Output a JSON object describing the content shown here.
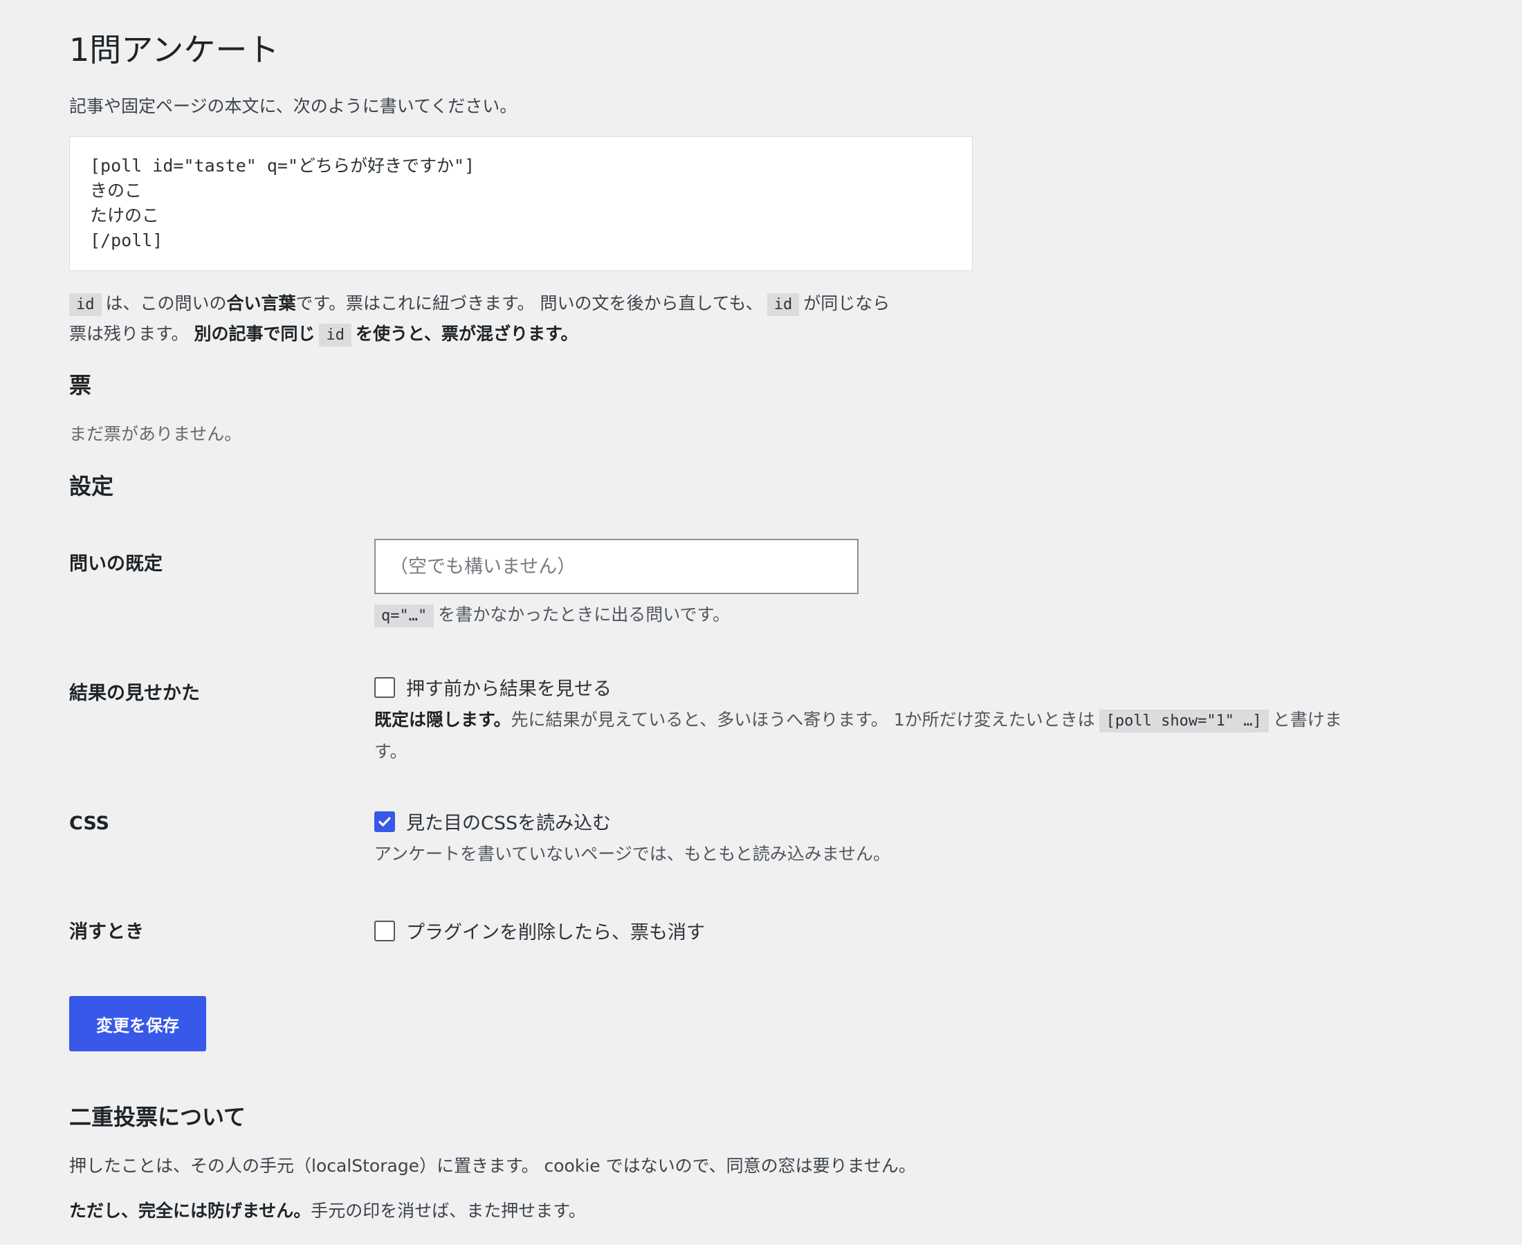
{
  "page": {
    "title": "1問アンケート",
    "intro": "記事や固定ページの本文に、次のように書いてください。"
  },
  "code_example": {
    "lines": [
      "[poll id=\"taste\" q=\"どちらが好きですか\"]",
      "きのこ",
      "たけのこ",
      "[/poll]"
    ]
  },
  "id_note": {
    "code": "id",
    "t1": "は、この問いの",
    "b1": "合い言葉",
    "t2": "です。票はこれに紐づきます。 問いの文を後から直しても、",
    "t3": "が同じなら",
    "t4": "票は残ります。",
    "b2": "別の記事で同じ",
    "b3": "を使うと、票が混ざります。"
  },
  "votes": {
    "heading": "票",
    "empty_text": "まだ票がありません。"
  },
  "settings": {
    "heading": "設定",
    "question_default": {
      "label": "問いの既定",
      "placeholder": "（空でも構いません）",
      "desc_code": "q=\"…\"",
      "desc_text": "を書かなかったときに出る問いです。"
    },
    "results_display": {
      "label": "結果の見せかた",
      "checkbox_label": "押す前から結果を見せる",
      "checked": false,
      "desc_bold": "既定は隠します。",
      "desc_text": "先に結果が見えていると、多いほうへ寄ります。 1か所だけ変えたいときは",
      "desc_code": "[poll show=\"1\" …]",
      "desc_tail": "と書けま",
      "desc_tail2": "す。"
    },
    "css": {
      "label": "CSS",
      "checkbox_label": "見た目のCSSを読み込む",
      "checked": true,
      "desc": "アンケートを書いていないページでは、もともと読み込みません。"
    },
    "uninstall": {
      "label": "消すとき",
      "checkbox_label": "プラグインを削除したら、票も消す",
      "checked": false
    },
    "save_label": "変更を保存"
  },
  "double_vote": {
    "heading": "二重投票について",
    "p1": "押したことは、その人の手元（localStorage）に置きます。 cookie ではないので、同意の窓は要りません。",
    "p2_bold": "ただし、完全には防げません。",
    "p2_text": "手元の印を消せば、また押せます。"
  },
  "colors": {
    "accent": "#3858e9",
    "background": "#f0f0f1"
  }
}
